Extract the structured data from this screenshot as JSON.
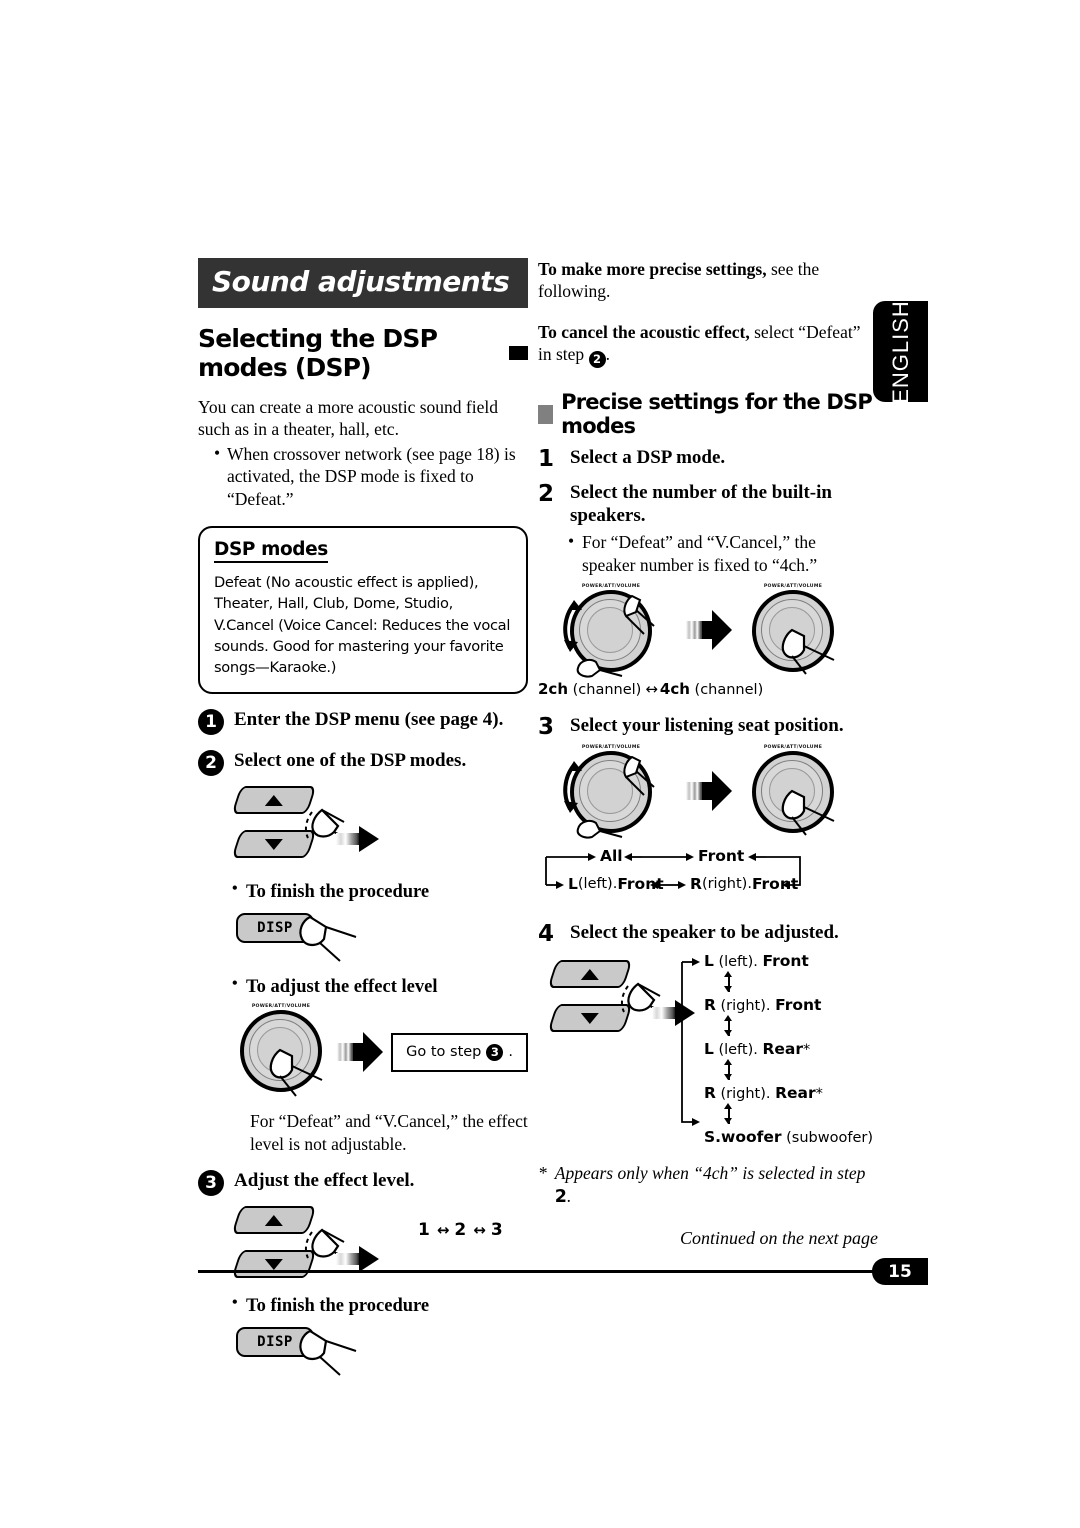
{
  "page": {
    "number": "15",
    "language_tab": "ENGLISH",
    "continued_note": "Continued on the next page"
  },
  "section": {
    "banner_title": "Sound adjustments",
    "heading": "Selecting the DSP modes (DSP)"
  },
  "intro": {
    "paragraph": "You can create a more acoustic sound field such as in a theater, hall, etc.",
    "bullet": "When crossover network (see page 18) is activated, the DSP mode is fixed to “Defeat.”"
  },
  "dsp_modes_box": {
    "title": "DSP modes",
    "text": "Defeat (No acoustic effect is applied), Theater, Hall, Club, Dome, Studio, V.Cancel (Voice Cancel: Reduces the vocal sounds. Good for mastering your favorite songs—Karaoke.)"
  },
  "left_steps": [
    {
      "marker": "1",
      "text": "Enter the DSP menu (see page 4)."
    },
    {
      "marker": "2",
      "text": "Select one of the DSP modes."
    },
    {
      "marker": "3",
      "text": "Adjust the effect level."
    }
  ],
  "left_sub": {
    "finish_1": "To finish the procedure",
    "finish_2": "To finish the procedure",
    "adjust_effect": "To adjust the effect level",
    "goto_prefix": "Go to step",
    "goto_marker": "3",
    "goto_suffix": ".",
    "defeat_note": "For “Defeat” and “V.Cancel,” the effect level is not adjustable.",
    "level_sequence": [
      "1",
      "2",
      "3"
    ]
  },
  "buttons": {
    "disp_label": "DISP",
    "up_icon": "triangle-up-icon",
    "down_icon": "triangle-down-icon",
    "knob_label": "POWER/ATT/VOLUME"
  },
  "right_intro": {
    "precise_bold": "To make more precise settings,",
    "precise_rest": " see the following.",
    "cancel_bold": "To cancel the acoustic effect,",
    "cancel_rest": " select “Defeat” in step ",
    "cancel_marker": "2",
    "cancel_end": "."
  },
  "right_heading": "Precise settings for the DSP modes",
  "right_steps": [
    {
      "num": "1",
      "text": "Select a DSP mode."
    },
    {
      "num": "2",
      "text": "Select the number of the built-in speakers."
    },
    {
      "num": "3",
      "text": "Select your listening seat position."
    },
    {
      "num": "4",
      "text": "Select the speaker to be adjusted."
    }
  ],
  "right_step2": {
    "bullet": "For “Defeat” and “V.Cancel,” the speaker number is fixed to “4ch.”",
    "caption_left_bold": "2ch",
    "caption_left_rest": " (channel)",
    "caption_right_bold": "4ch",
    "caption_right_rest": " (channel)"
  },
  "seat_cycle": {
    "top": [
      {
        "bold": "All",
        "plain": ""
      },
      {
        "bold": "Front",
        "plain": ""
      }
    ],
    "bottom": [
      {
        "bold_a": "L",
        "plain": " (left). ",
        "bold_b": "Front"
      },
      {
        "bold_a": "R",
        "plain": " (right). ",
        "bold_b": "Front"
      }
    ]
  },
  "speaker_cycle": {
    "items": [
      {
        "bold_a": "L",
        "plain": " (left). ",
        "bold_b": "Front",
        "star": ""
      },
      {
        "bold_a": "R",
        "plain": " (right). ",
        "bold_b": "Front",
        "star": ""
      },
      {
        "bold_a": "L",
        "plain": " (left). ",
        "bold_b": "Rear",
        "star": "*"
      },
      {
        "bold_a": "R",
        "plain": " (right). ",
        "bold_b": "Rear",
        "star": "*"
      },
      {
        "bold_a": "S.woofer",
        "plain": " (subwoofer)",
        "bold_b": "",
        "star": ""
      }
    ],
    "footnote_prefix": "*",
    "footnote_text": "Appears only when “4ch” is selected in step",
    "footnote_marker": "2",
    "footnote_end": "."
  }
}
